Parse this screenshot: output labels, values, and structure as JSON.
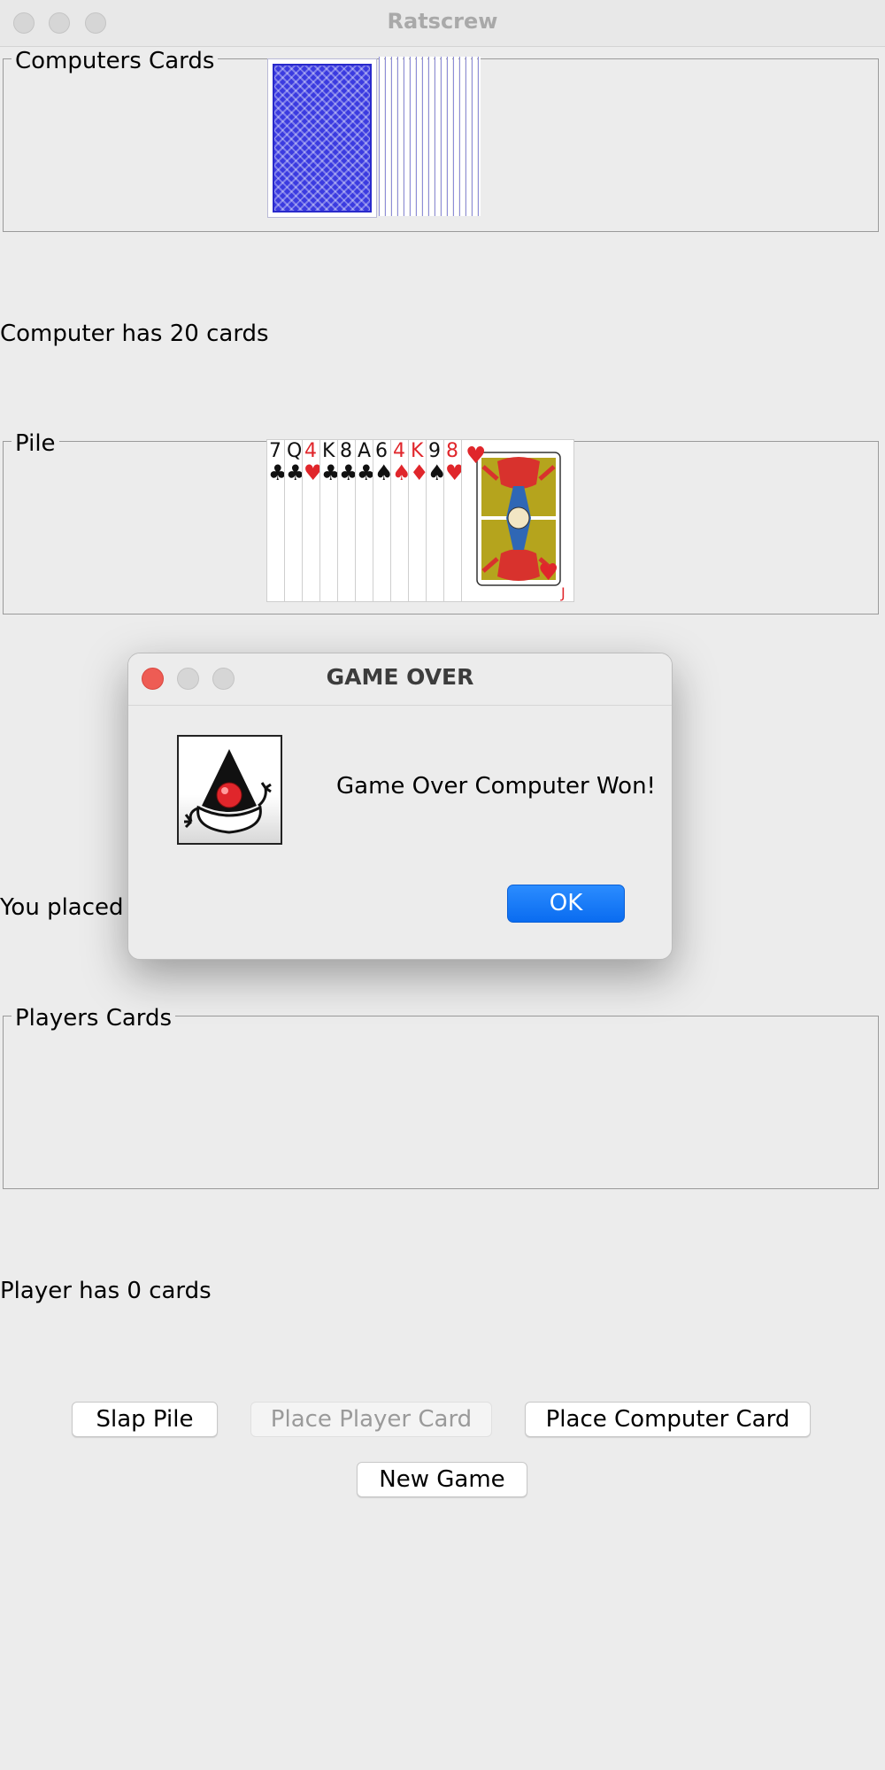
{
  "window": {
    "title": "Ratscrew"
  },
  "computer_panel": {
    "title": "Computers Cards",
    "count_text": "Computer has 20 cards"
  },
  "pile_panel": {
    "title": "Pile",
    "cards": [
      {
        "rank": "7",
        "suit": "♣",
        "color": "#111111"
      },
      {
        "rank": "Q",
        "suit": "♣",
        "color": "#111111"
      },
      {
        "rank": "4",
        "suit": "♥",
        "color": "#e0262b"
      },
      {
        "rank": "K",
        "suit": "♣",
        "color": "#111111"
      },
      {
        "rank": "8",
        "suit": "♣",
        "color": "#111111"
      },
      {
        "rank": "A",
        "suit": "♣",
        "color": "#111111"
      },
      {
        "rank": "6",
        "suit": "♠",
        "color": "#111111"
      },
      {
        "rank": "4",
        "suit": "♠",
        "color": "#e0262b"
      },
      {
        "rank": "K",
        "suit": "♦",
        "color": "#e0262b"
      },
      {
        "rank": "9",
        "suit": "♠",
        "color": "#111111"
      },
      {
        "rank": "8",
        "suit": "♥",
        "color": "#e0262b"
      },
      {
        "rank": "J",
        "suit": "♥",
        "color": "#e0262b"
      }
    ],
    "top_card": {
      "rank": "J",
      "suit": "♥",
      "label": "jack-of-hearts"
    }
  },
  "last_move_text": "You placed",
  "player_panel": {
    "title": "Players Cards",
    "count_text": "Player has 0 cards"
  },
  "buttons": {
    "slap_pile": "Slap Pile",
    "place_player_card": "Place Player Card",
    "place_computer_card": "Place Computer Card",
    "new_game": "New Game"
  },
  "dialog": {
    "title": "GAME OVER",
    "message": "Game Over Computer Won!",
    "ok_label": "OK",
    "icon": "java-duke-icon"
  },
  "colors": {
    "card_back": "#3b3be0",
    "red_suit": "#e0262b",
    "ok_button": "#0a6cf0",
    "close_light": "#ee5c54"
  }
}
